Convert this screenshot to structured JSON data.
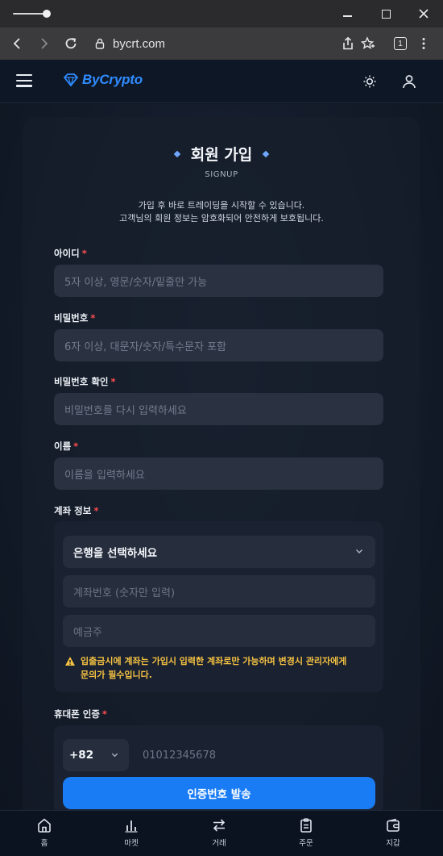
{
  "browser": {
    "url": "bycrt.com",
    "tab_count": "1"
  },
  "header": {
    "logo_text": "ByCrypto"
  },
  "signup": {
    "title": "회원 가입",
    "subtitle": "SIGNUP",
    "intro_line1": "가입 후 바로 트레이딩을 시작할 수 있습니다.",
    "intro_line2": "고객님의 회원 정보는 암호화되어 안전하게 보호됩니다.",
    "required_mark": "*",
    "fields": {
      "user_id": {
        "label": "아이디",
        "placeholder": "5자 이상, 영문/숫자/밑줄만 가능"
      },
      "password": {
        "label": "비밀번호",
        "placeholder": "6자 이상, 대문자/숫자/특수문자 포함"
      },
      "password_confirm": {
        "label": "비밀번호 확인",
        "placeholder": "비밀번호를 다시 입력하세요"
      },
      "name": {
        "label": "이름",
        "placeholder": "이름을 입력하세요"
      }
    },
    "account": {
      "label": "계좌 정보",
      "bank_select": "은행을 선택하세요",
      "account_number_placeholder": "계좌번호 (숫자만 입력)",
      "holder_placeholder": "예금주",
      "warning_line1": "입출금시에 계좌는 가입시 입력한 계좌로만 가능하며 변경시 관리자에게",
      "warning_line2": "문의가 필수입니다."
    },
    "phone": {
      "label": "휴대폰 인증",
      "country_code": "+82",
      "phone_placeholder": "01012345678",
      "send_button": "인증번호 발송"
    }
  },
  "bottom_nav": {
    "items": [
      {
        "label": "홈",
        "icon": "home-icon"
      },
      {
        "label": "마켓",
        "icon": "chart-bars-icon"
      },
      {
        "label": "거래",
        "icon": "swap-arrows-icon"
      },
      {
        "label": "주문",
        "icon": "clipboard-icon"
      },
      {
        "label": "지갑",
        "icon": "wallet-icon"
      }
    ]
  },
  "colors": {
    "accent": "#1a7cf5",
    "warning": "#f5c242",
    "required": "#ff4d4f"
  }
}
